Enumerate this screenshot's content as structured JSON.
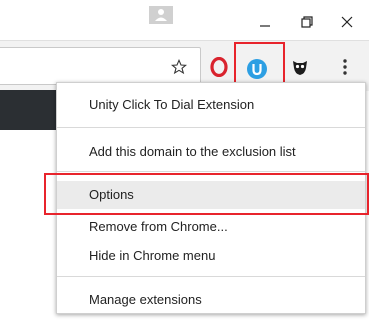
{
  "window": {
    "profile_icon": "person-icon",
    "minimize_icon": "minimize-icon",
    "restore_icon": "restore-icon",
    "close_icon": "close-icon"
  },
  "toolbar": {
    "bookmark_icon": "star-icon",
    "extensions": [
      {
        "name": "opera-icon",
        "color": "#d9232e"
      },
      {
        "name": "unity-click-to-dial-icon",
        "color": "#2d9fe3"
      },
      {
        "name": "owl-icon",
        "color": "#1d1d1d"
      }
    ],
    "menu_icon": "three-dots-icon",
    "highlight_color": "#e8242c"
  },
  "context_menu": {
    "title": "Unity Click To Dial Extension",
    "items": [
      "Add this domain to the exclusion list",
      "Options",
      "Remove from Chrome...",
      "Hide in Chrome menu",
      "Manage extensions"
    ],
    "hovered_item": "Options"
  }
}
